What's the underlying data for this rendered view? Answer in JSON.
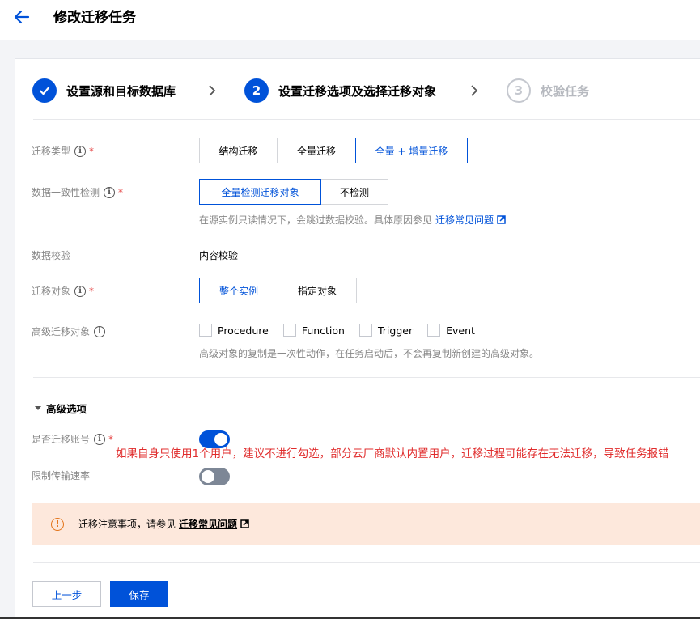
{
  "header": {
    "title": "修改迁移任务"
  },
  "steps": [
    {
      "label": "设置源和目标数据库",
      "state": "done",
      "number": ""
    },
    {
      "label": "设置迁移选项及选择迁移对象",
      "state": "active",
      "number": "2"
    },
    {
      "label": "校验任务",
      "state": "todo",
      "number": "3"
    }
  ],
  "form": {
    "migration_type": {
      "label": "迁移类型",
      "options": [
        "结构迁移",
        "全量迁移",
        "全量 + 增量迁移"
      ],
      "selected": "全量 + 增量迁移"
    },
    "consistency_check": {
      "label": "数据一致性检测",
      "options": [
        "全量检测迁移对象",
        "不检测"
      ],
      "selected": "全量检测迁移对象",
      "help": "在源实例只读情况下，会跳过数据校验。具体原因参见",
      "help_link": "迁移常见问题"
    },
    "data_verify": {
      "label": "数据校验",
      "value": "内容校验"
    },
    "migration_object": {
      "label": "迁移对象",
      "options": [
        "整个实例",
        "指定对象"
      ],
      "selected": "整个实例"
    },
    "advanced_objects": {
      "label": "高级迁移对象",
      "options": [
        "Procedure",
        "Function",
        "Trigger",
        "Event"
      ],
      "help": "高级对象的复制是一次性动作，在任务启动后，不会再复制新创建的高级对象。"
    }
  },
  "advanced": {
    "title": "高级选项",
    "migrate_account": {
      "label": "是否迁移账号",
      "on": true
    },
    "annotation": "如果自身只使用1个用户，建议不进行勾选，部分云厂商默认内置用户，迁移过程可能存在无法迁移，导致任务报错",
    "limit_speed": {
      "label": "限制传输速率",
      "on": false
    }
  },
  "notice": {
    "text": "迁移注意事项，请参见",
    "link": "迁移常见问题"
  },
  "buttons": {
    "prev": "上一步",
    "save": "保存"
  },
  "colors": {
    "primary": "#0052d9",
    "warning": "#e37318",
    "annotation": "#e02c2c",
    "notice_bg": "#fde8dc"
  }
}
